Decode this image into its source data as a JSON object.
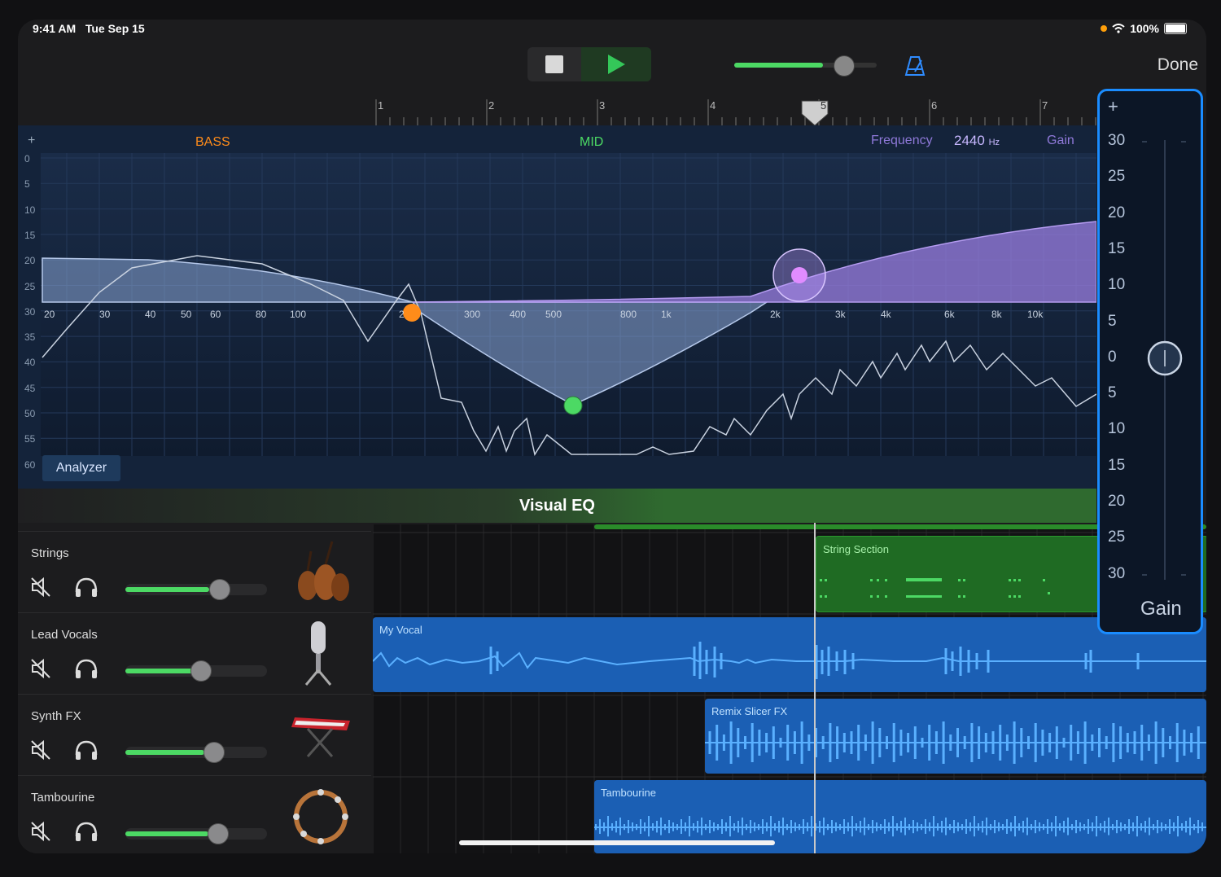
{
  "status": {
    "time": "9:41 AM",
    "date": "Tue Sep 15",
    "battery": "100%"
  },
  "toolbar": {
    "done_label": "Done",
    "stop_icon": "stop-icon",
    "play_icon": "play-icon",
    "metronome_icon": "metronome-icon",
    "master_volume": 0.62
  },
  "ruler": {
    "bars": [
      "1",
      "2",
      "3",
      "4",
      "5",
      "6",
      "7"
    ]
  },
  "eq": {
    "plus": "+",
    "bass_label": "BASS",
    "mid_label": "MID",
    "frequency_label": "Frequency",
    "frequency_value": "2440",
    "frequency_unit": "Hz",
    "gain_label": "Gain",
    "y_labels": [
      "0",
      "5",
      "10",
      "15",
      "20",
      "25",
      "30",
      "35",
      "40",
      "45",
      "50",
      "55",
      "60"
    ],
    "x_labels": [
      "20",
      "30",
      "40",
      "50",
      "60",
      "80",
      "100",
      "2",
      "300",
      "400",
      "500",
      "800",
      "1k",
      "2k",
      "3k",
      "4k",
      "6k",
      "8k",
      "10k"
    ],
    "analyzer_label": "Analyzer",
    "title": "Visual EQ",
    "colors": {
      "bass": "#ff8c1a",
      "mid": "#4cd964",
      "treble": "#b98cff"
    }
  },
  "tracks": [
    {
      "name": "Strings",
      "volume": 0.66,
      "instrument_icon": "strings-icon"
    },
    {
      "name": "Lead Vocals",
      "volume": 0.53,
      "instrument_icon": "microphone-icon"
    },
    {
      "name": "Synth FX",
      "volume": 0.62,
      "instrument_icon": "keyboard-icon"
    },
    {
      "name": "Tambourine",
      "volume": 0.65,
      "instrument_icon": "tambourine-icon"
    }
  ],
  "regions": {
    "strings": "String Section",
    "vocal": "My Vocal",
    "synth": "Remix Slicer FX",
    "tambourine": "Tambourine"
  },
  "gain_slider": {
    "plus": "+",
    "labels": [
      "30",
      "25",
      "20",
      "15",
      "10",
      "5",
      "0",
      "5",
      "10",
      "15",
      "20",
      "25",
      "30"
    ],
    "title": "Gain",
    "value": 0
  }
}
